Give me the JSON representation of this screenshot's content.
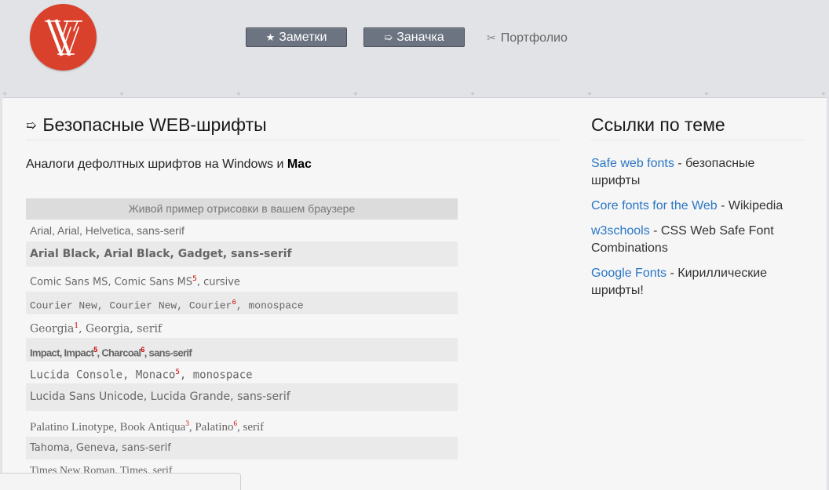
{
  "header": {
    "logo_letters": "W",
    "nav": [
      {
        "icon": "★",
        "label": "Заметки"
      },
      {
        "icon": "➯",
        "label": "Заначка"
      },
      {
        "icon": "✂",
        "label": "Портфолио"
      }
    ]
  },
  "main": {
    "title_icon": "➯",
    "title": "Безопасные WEB-шрифты",
    "subtitle_prefix": "Аналоги дефолтных шрифтов на Windows и ",
    "subtitle_bold": "Mac",
    "table_header": "Живой пример отрисовки в вашем браузере",
    "rows": [
      {
        "parts": [
          "Arial, Arial, Helvetica, sans-serif"
        ],
        "sups": []
      },
      {
        "parts": [
          "Arial Black, Arial Black, Gadget, sans-serif"
        ],
        "sups": []
      },
      {
        "parts": [
          "Comic Sans MS, Comic Sans MS",
          ", cursive"
        ],
        "sups": [
          "5"
        ]
      },
      {
        "parts": [
          "Courier New, Courier New, Courier",
          ", monospace"
        ],
        "sups": [
          "6"
        ]
      },
      {
        "parts": [
          "Georgia",
          ", Georgia, serif"
        ],
        "sups": [
          "1"
        ]
      },
      {
        "parts": [
          "Impact, Impact",
          ", Charcoal",
          ", sans-serif"
        ],
        "sups": [
          "5",
          "6"
        ]
      },
      {
        "parts": [
          "Lucida Console, Monaco",
          ", monospace"
        ],
        "sups": [
          "5"
        ]
      },
      {
        "parts": [
          "Lucida Sans Unicode, Lucida Grande, sans-serif"
        ],
        "sups": []
      },
      {
        "parts": [
          "Palatino Linotype, Book Antiqua",
          ", Palatino",
          ", serif"
        ],
        "sups": [
          "3",
          "6"
        ]
      },
      {
        "parts": [
          "Tahoma, Geneva, sans-serif"
        ],
        "sups": []
      },
      {
        "parts": [
          "Times New Roman, Times, serif"
        ],
        "sups": []
      }
    ]
  },
  "sidebar": {
    "title": "Ссылки по теме",
    "links": [
      {
        "link": "Safe web fonts",
        "rest": " - безопасные шрифты"
      },
      {
        "link": "Core fonts for the Web",
        "rest": " - Wikipedia"
      },
      {
        "link": "w3schools",
        "rest": " - CSS Web Safe Font Combinations"
      },
      {
        "link": "Google Fonts",
        "rest": " - Кириллические шрифты!"
      }
    ]
  },
  "colors": {
    "logo": "#d9412c",
    "nav_button": "#6b7480",
    "link": "#2a76c6",
    "sup": "#cc0000"
  }
}
